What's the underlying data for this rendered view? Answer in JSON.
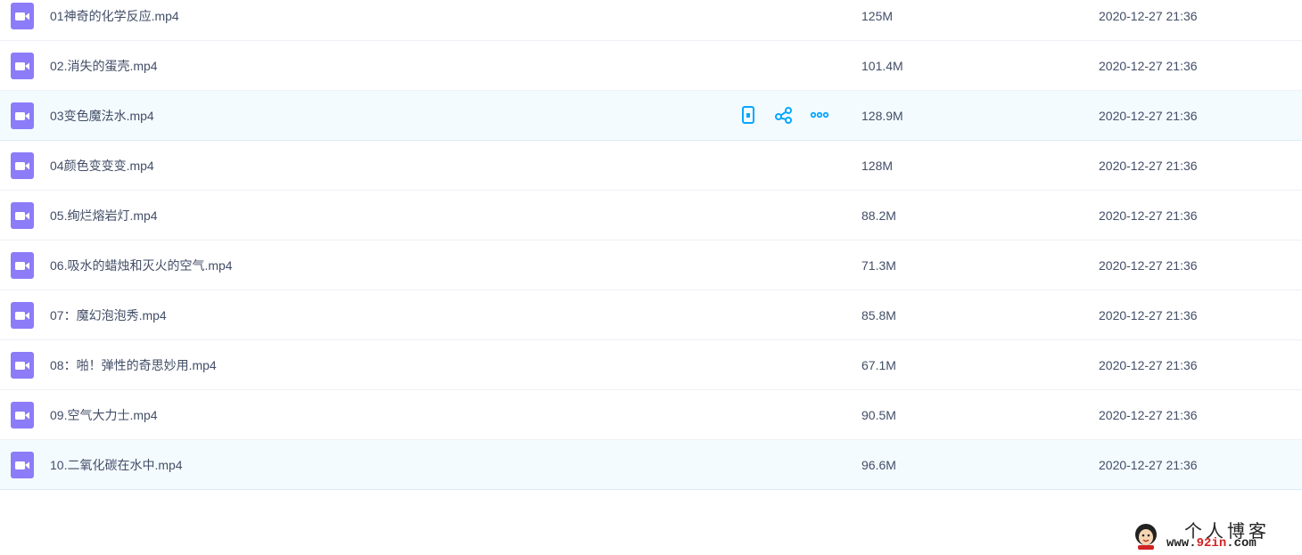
{
  "files": [
    {
      "name": "01神奇的化学反应.mp4",
      "size": "125M",
      "date": "2020-12-27 21:36"
    },
    {
      "name": "02.消失的蛋壳.mp4",
      "size": "101.4M",
      "date": "2020-12-27 21:36"
    },
    {
      "name": "03变色魔法水.mp4",
      "size": "128.9M",
      "date": "2020-12-27 21:36"
    },
    {
      "name": "04颜色变变变.mp4",
      "size": "128M",
      "date": "2020-12-27 21:36"
    },
    {
      "name": "05.绚烂熔岩灯.mp4",
      "size": "88.2M",
      "date": "2020-12-27 21:36"
    },
    {
      "name": "06.吸水的蜡烛和灭火的空气.mp4",
      "size": "71.3M",
      "date": "2020-12-27 21:36"
    },
    {
      "name": "07：魔幻泡泡秀.mp4",
      "size": "85.8M",
      "date": "2020-12-27 21:36"
    },
    {
      "name": "08：啪！弹性的奇思妙用.mp4",
      "size": "67.1M",
      "date": "2020-12-27 21:36"
    },
    {
      "name": "09.空气大力士.mp4",
      "size": "90.5M",
      "date": "2020-12-27 21:36"
    },
    {
      "name": "10.二氧化碳在水中.mp4",
      "size": "96.6M",
      "date": "2020-12-27 21:36"
    }
  ],
  "hover_row_index": 2,
  "selected_row_index": 9,
  "row_actions": {
    "icons": [
      "phone-icon",
      "share-icon",
      "more-icon"
    ]
  },
  "icon": "video-file-icon",
  "colors": {
    "file_icon": "#8c7cf7",
    "action_icon": "#06a7ff",
    "hover_bg": "#f4fbff",
    "text": "#424e67"
  },
  "watermark": {
    "title": "个人博客",
    "url_prefix": "www.",
    "url_accent": "92in",
    "url_suffix": ".com"
  }
}
